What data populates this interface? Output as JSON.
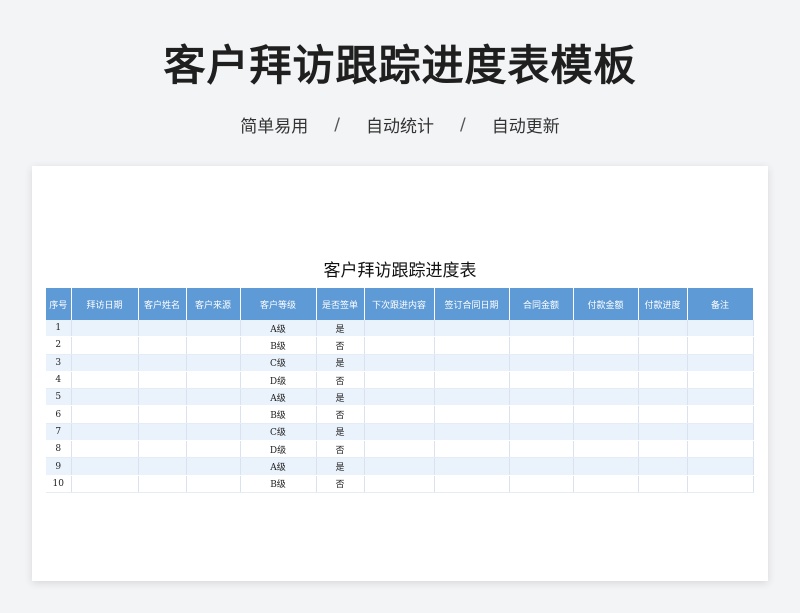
{
  "page": {
    "title": "客户拜访跟踪进度表模板",
    "tags": [
      "简单易用",
      "自动统计",
      "自动更新"
    ],
    "separator": "/"
  },
  "sheet": {
    "title": "客户拜访跟踪进度表",
    "header_color": "#5d9ad6",
    "stripe_color": "#eaf2fb",
    "columns": [
      "序号",
      "拜访日期",
      "客户姓名",
      "客户来源",
      "客户等级",
      "是否签单",
      "下次跟进内容",
      "签订合同日期",
      "合同金额",
      "付款金额",
      "付款进度",
      "备注"
    ],
    "rows": [
      {
        "no": "1",
        "level": "A级",
        "signed": "是"
      },
      {
        "no": "2",
        "level": "B级",
        "signed": "否"
      },
      {
        "no": "3",
        "level": "C级",
        "signed": "是"
      },
      {
        "no": "4",
        "level": "D级",
        "signed": "否"
      },
      {
        "no": "5",
        "level": "A级",
        "signed": "是"
      },
      {
        "no": "6",
        "level": "B级",
        "signed": "否"
      },
      {
        "no": "7",
        "level": "C级",
        "signed": "是"
      },
      {
        "no": "8",
        "level": "D级",
        "signed": "否"
      },
      {
        "no": "9",
        "level": "A级",
        "signed": "是"
      },
      {
        "no": "10",
        "level": "B级",
        "signed": "否"
      }
    ]
  }
}
